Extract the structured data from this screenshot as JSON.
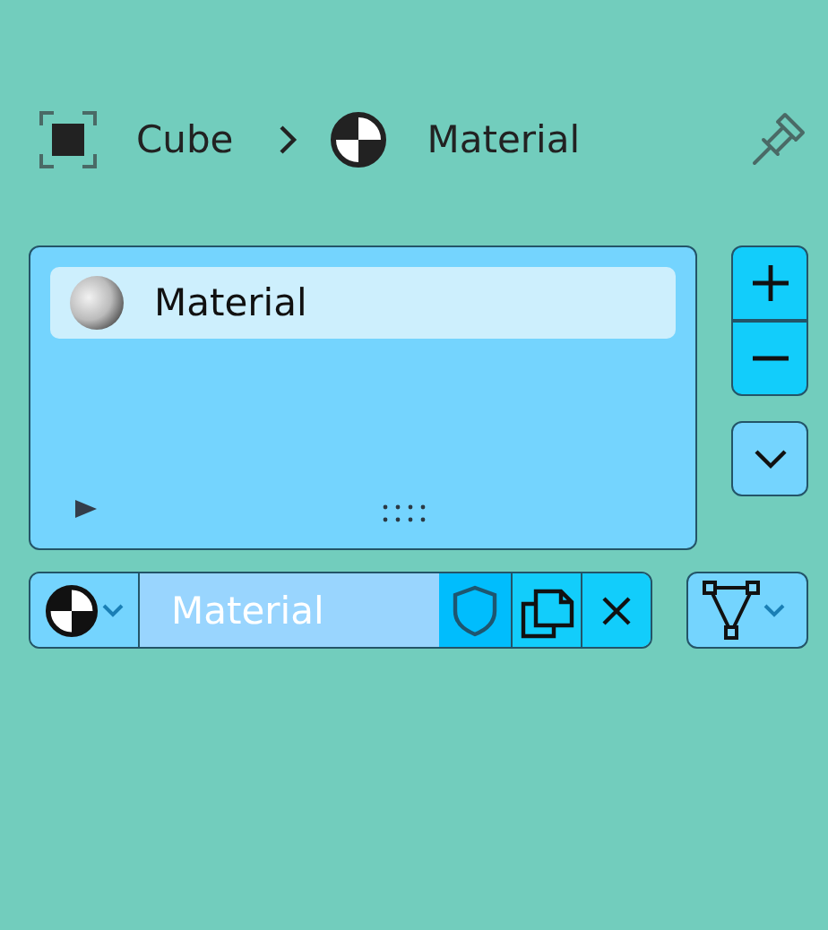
{
  "breadcrumb": [
    {
      "kind": "object",
      "label": "Cube"
    },
    {
      "kind": "material",
      "label": "Material"
    }
  ],
  "material_slots": [
    {
      "name": "Material",
      "selected": true
    }
  ],
  "datablock": {
    "name": "Material"
  }
}
